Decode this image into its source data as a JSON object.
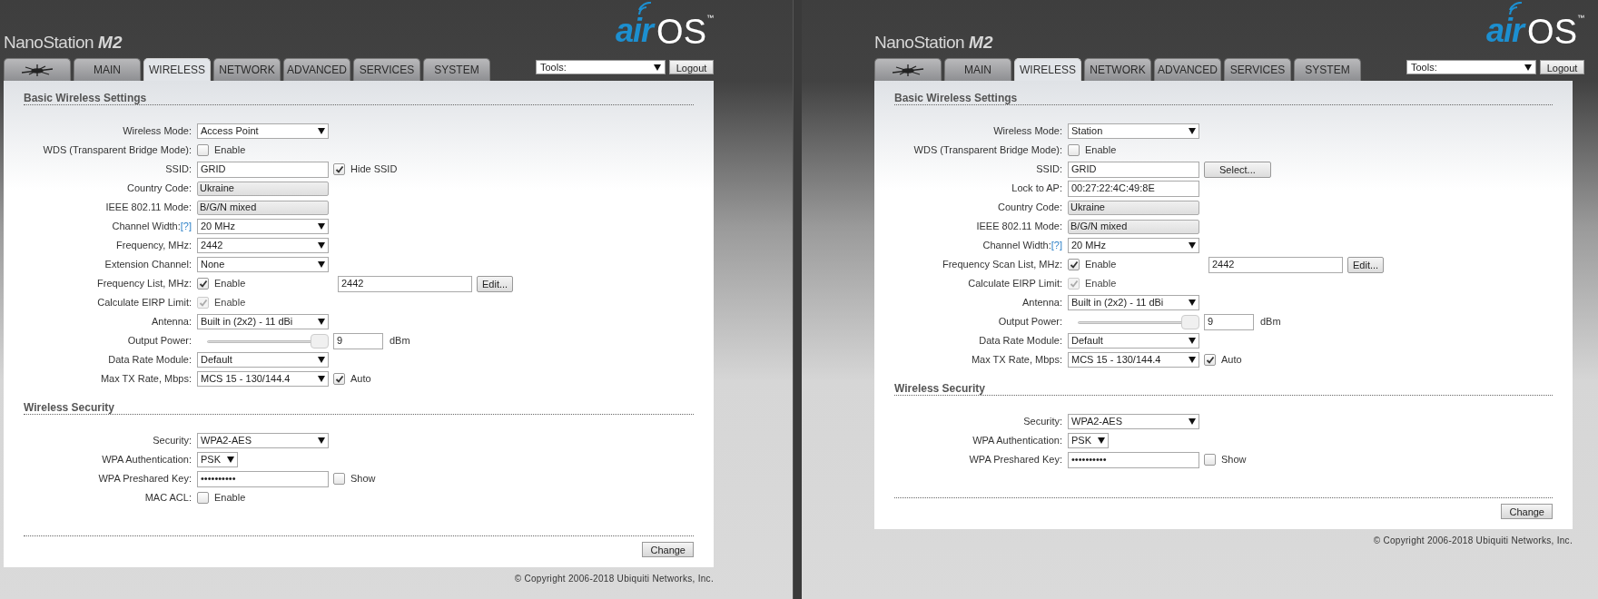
{
  "panes": [
    {
      "header": {
        "title": "NanoStation",
        "model": "M2",
        "logo_air": "air",
        "logo_os": "OS",
        "logo_tm": "™"
      },
      "tabs": [
        {
          "kind": "logo",
          "selected": false
        },
        {
          "kind": "text",
          "label": "MAIN",
          "selected": false
        },
        {
          "kind": "text",
          "label": "WIRELESS",
          "selected": true
        },
        {
          "kind": "text",
          "label": "NETWORK",
          "selected": false
        },
        {
          "kind": "text",
          "label": "ADVANCED",
          "selected": false
        },
        {
          "kind": "text",
          "label": "SERVICES",
          "selected": false
        },
        {
          "kind": "text",
          "label": "SYSTEM",
          "selected": false
        }
      ],
      "tools": "Tools:",
      "logout": "Logout",
      "sections": [
        {
          "title": "Basic Wireless Settings",
          "rows": [
            {
              "label": "Wireless Mode:",
              "controls": [
                {
                  "kind": "dropdown",
                  "value": "Access Point"
                }
              ]
            },
            {
              "label": "WDS (Transparent Bridge Mode):",
              "controls": [
                {
                  "kind": "checkbox",
                  "text": "Enable",
                  "checked": false,
                  "disabled": false
                }
              ]
            },
            {
              "label": "SSID:",
              "controls": [
                {
                  "kind": "input",
                  "value": "GRID"
                },
                {
                  "kind": "checkbox",
                  "text": "Hide SSID",
                  "checked": true,
                  "disabled": false
                }
              ]
            },
            {
              "label": "Country Code:",
              "controls": [
                {
                  "kind": "readonly",
                  "value": "Ukraine"
                }
              ]
            },
            {
              "label": "IEEE 802.11 Mode:",
              "controls": [
                {
                  "kind": "readonly",
                  "value": "B/G/N mixed"
                }
              ]
            },
            {
              "label": "Channel Width:",
              "help": "[?]",
              "controls": [
                {
                  "kind": "dropdown",
                  "value": "20 MHz"
                }
              ]
            },
            {
              "label": "Frequency, MHz:",
              "controls": [
                {
                  "kind": "dropdown",
                  "value": "2442"
                }
              ]
            },
            {
              "label": "Extension Channel:",
              "controls": [
                {
                  "kind": "dropdown",
                  "value": "None"
                }
              ]
            },
            {
              "label": "Frequency List, MHz:",
              "controls": [
                {
                  "kind": "checkbox",
                  "text": "Enable",
                  "checked": true,
                  "disabled": false
                },
                {
                  "kind": "long-input",
                  "value": "2442"
                },
                {
                  "kind": "button",
                  "text": "Edit..."
                }
              ]
            },
            {
              "label": "Calculate EIRP Limit:",
              "controls": [
                {
                  "kind": "checkbox",
                  "text": "Enable",
                  "checked": true,
                  "disabled": true
                }
              ]
            },
            {
              "label": "Antenna:",
              "controls": [
                {
                  "kind": "dropdown",
                  "value": "Built in (2x2) - 11 dBi"
                }
              ]
            },
            {
              "label": "Output Power:",
              "controls": [
                {
                  "kind": "slider",
                  "level": 1
                },
                {
                  "kind": "short-input",
                  "value": "9"
                },
                {
                  "kind": "unit",
                  "text": "dBm"
                }
              ]
            },
            {
              "label": "Data Rate Module:",
              "controls": [
                {
                  "kind": "dropdown",
                  "value": "Default"
                }
              ]
            },
            {
              "label": "Max TX Rate, Mbps:",
              "controls": [
                {
                  "kind": "dropdown",
                  "value": "MCS 15 - 130/144.4"
                },
                {
                  "kind": "checkbox",
                  "text": "Auto",
                  "checked": true,
                  "disabled": false
                }
              ]
            }
          ]
        },
        {
          "title": "Wireless Security",
          "rows": [
            {
              "label": "Security:",
              "controls": [
                {
                  "kind": "dropdown",
                  "value": "WPA2-AES"
                }
              ]
            },
            {
              "label": "WPA Authentication:",
              "controls": [
                {
                  "kind": "short-dropdown",
                  "value": "PSK"
                }
              ]
            },
            {
              "label": "WPA Preshared Key:",
              "controls": [
                {
                  "kind": "input",
                  "value": "••••••••••"
                },
                {
                  "kind": "checkbox",
                  "text": "Show",
                  "checked": false,
                  "disabled": false
                }
              ]
            },
            {
              "label": "MAC ACL:",
              "controls": [
                {
                  "kind": "checkbox",
                  "text": "Enable",
                  "checked": false,
                  "disabled": false
                }
              ]
            }
          ]
        }
      ],
      "button": "Change",
      "copyright": "© Copyright 2006-2018 Ubiquiti Networks, Inc."
    },
    {
      "header": {
        "title": "NanoStation",
        "model": "M2",
        "logo_air": "air",
        "logo_os": "OS",
        "logo_tm": "™"
      },
      "tabs": [
        {
          "kind": "logo",
          "selected": false
        },
        {
          "kind": "text",
          "label": "MAIN",
          "selected": false
        },
        {
          "kind": "text",
          "label": "WIRELESS",
          "selected": true
        },
        {
          "kind": "text",
          "label": "NETWORK",
          "selected": false
        },
        {
          "kind": "text",
          "label": "ADVANCED",
          "selected": false
        },
        {
          "kind": "text",
          "label": "SERVICES",
          "selected": false
        },
        {
          "kind": "text",
          "label": "SYSTEM",
          "selected": false
        }
      ],
      "tools": "Tools:",
      "logout": "Logout",
      "sections": [
        {
          "title": "Basic Wireless Settings",
          "rows": [
            {
              "label": "Wireless Mode:",
              "controls": [
                {
                  "kind": "dropdown",
                  "value": "Station"
                }
              ]
            },
            {
              "label": "WDS (Transparent Bridge Mode):",
              "controls": [
                {
                  "kind": "checkbox",
                  "text": "Enable",
                  "checked": false,
                  "disabled": false
                }
              ]
            },
            {
              "label": "SSID:",
              "controls": [
                {
                  "kind": "input",
                  "value": "GRID"
                },
                {
                  "kind": "wide-button",
                  "text": "Select..."
                }
              ]
            },
            {
              "label": "Lock to AP:",
              "controls": [
                {
                  "kind": "input",
                  "value": "00:27:22:4C:49:8E"
                }
              ]
            },
            {
              "label": "Country Code:",
              "controls": [
                {
                  "kind": "readonly",
                  "value": "Ukraine"
                }
              ]
            },
            {
              "label": "IEEE 802.11 Mode:",
              "controls": [
                {
                  "kind": "readonly",
                  "value": "B/G/N mixed"
                }
              ]
            },
            {
              "label": "Channel Width:",
              "help": "[?]",
              "controls": [
                {
                  "kind": "dropdown",
                  "value": "20 MHz"
                }
              ]
            },
            {
              "label": "Frequency Scan List, MHz:",
              "controls": [
                {
                  "kind": "checkbox",
                  "text": "Enable",
                  "checked": true,
                  "disabled": false
                },
                {
                  "kind": "long-input",
                  "value": "2442"
                },
                {
                  "kind": "button",
                  "text": "Edit..."
                }
              ]
            },
            {
              "label": "Calculate EIRP Limit:",
              "controls": [
                {
                  "kind": "checkbox",
                  "text": "Enable",
                  "checked": true,
                  "disabled": true
                }
              ]
            },
            {
              "label": "Antenna:",
              "controls": [
                {
                  "kind": "dropdown",
                  "value": "Built in (2x2) - 11 dBi"
                }
              ]
            },
            {
              "label": "Output Power:",
              "controls": [
                {
                  "kind": "slider",
                  "level": 1
                },
                {
                  "kind": "short-input",
                  "value": "9"
                },
                {
                  "kind": "unit",
                  "text": "dBm"
                }
              ]
            },
            {
              "label": "Data Rate Module:",
              "controls": [
                {
                  "kind": "dropdown",
                  "value": "Default"
                }
              ]
            },
            {
              "label": "Max TX Rate, Mbps:",
              "controls": [
                {
                  "kind": "dropdown",
                  "value": "MCS 15 - 130/144.4"
                },
                {
                  "kind": "checkbox",
                  "text": "Auto",
                  "checked": true,
                  "disabled": false
                }
              ]
            }
          ]
        },
        {
          "title": "Wireless Security",
          "rows": [
            {
              "label": "Security:",
              "controls": [
                {
                  "kind": "dropdown",
                  "value": "WPA2-AES"
                }
              ]
            },
            {
              "label": "WPA Authentication:",
              "controls": [
                {
                  "kind": "short-dropdown",
                  "value": "PSK"
                }
              ]
            },
            {
              "label": "WPA Preshared Key:",
              "controls": [
                {
                  "kind": "input",
                  "value": "••••••••••"
                },
                {
                  "kind": "checkbox",
                  "text": "Show",
                  "checked": false,
                  "disabled": false
                }
              ]
            }
          ]
        }
      ],
      "button": "Change",
      "copyright": "© Copyright 2006-2018 Ubiquiti Networks, Inc."
    }
  ]
}
